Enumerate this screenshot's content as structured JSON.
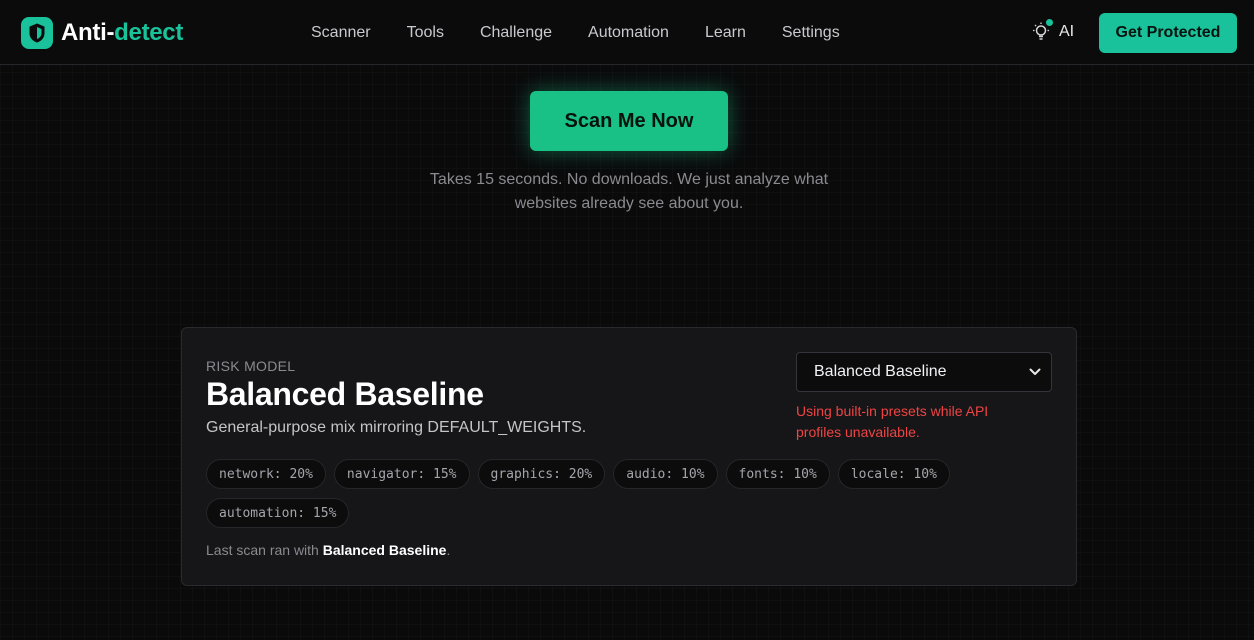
{
  "brand": {
    "name_part1": "Anti-",
    "name_part2": "detect",
    "accent_color": "#19c29a",
    "icon": "shield-icon"
  },
  "nav": {
    "links": [
      "Scanner",
      "Tools",
      "Challenge",
      "Automation",
      "Learn",
      "Settings"
    ],
    "ai_label": "AI",
    "ai_icon": "lightbulb-icon",
    "cta_label": "Get Protected"
  },
  "hero": {
    "scan_button_label": "Scan Me Now",
    "subtitle": "Takes 15 seconds. No downloads. We just analyze what websites already see about you."
  },
  "risk_model": {
    "eyebrow": "RISK MODEL",
    "title": "Balanced Baseline",
    "description": "General-purpose mix mirroring DEFAULT_WEIGHTS.",
    "select_value": "Balanced Baseline",
    "warning": "Using built-in presets while API profiles unavailable.",
    "warning_color": "#ef4444",
    "weights": [
      "network: 20%",
      "navigator: 15%",
      "graphics: 20%",
      "audio: 10%",
      "fonts: 10%",
      "locale: 10%",
      "automation: 15%"
    ],
    "last_scan_prefix": "Last scan ran with ",
    "last_scan_model": "Balanced Baseline",
    "last_scan_suffix": "."
  }
}
